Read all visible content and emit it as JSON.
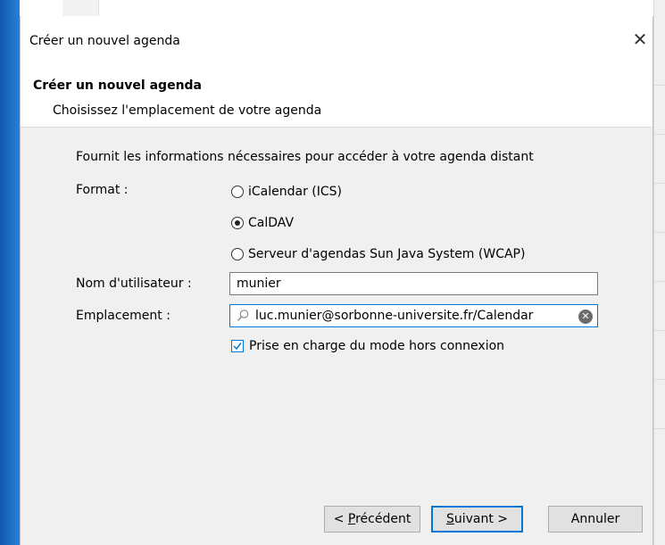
{
  "window": {
    "title": "Créer un nouvel agenda",
    "close_glyph": "✕"
  },
  "header": {
    "title": "Créer un nouvel agenda",
    "subtitle": "Choisissez l'emplacement de votre agenda"
  },
  "form": {
    "intro": "Fournit les informations nécessaires pour accéder à votre agenda distant",
    "format_label": "Format :",
    "format_options": [
      {
        "label": "iCalendar (ICS)",
        "selected": false
      },
      {
        "label": "CalDAV",
        "selected": true
      },
      {
        "label": "Serveur d'agendas Sun Java System (WCAP)",
        "selected": false
      }
    ],
    "username_label": "Nom d'utilisateur :",
    "username_value": "munier",
    "location_label": "Emplacement :",
    "location_value": "luc.munier@sorbonne-universite.fr/Calendar",
    "offline_label": "Prise en charge du mode hors connexion",
    "offline_checked": true
  },
  "buttons": {
    "previous_prefix": "< ",
    "previous_access": "P",
    "previous_rest": "récédent",
    "next_access": "S",
    "next_rest": "uivant >",
    "cancel": "Annuler"
  },
  "icons": [
    "close-icon",
    "search-icon",
    "clear-icon",
    "checkmark-icon"
  ],
  "colors": {
    "accent": "#0078d7",
    "dialog_bg": "#f0f0f0",
    "taskbar_blue": "#1e6fc6"
  }
}
